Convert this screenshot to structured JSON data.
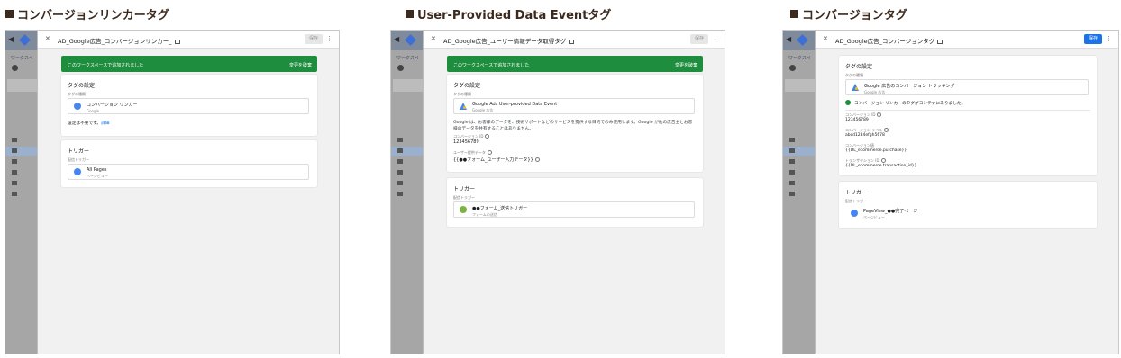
{
  "panels": [
    {
      "heading": "コンバージョンリンカータグ",
      "sidebar_partial": [
        "サマリ",
        "タグ",
        "トリガ",
        "変数",
        "フォルダ",
        "テンプ"
      ],
      "dialog": {
        "title": "AD_Google広告_コンバージョンリンカー_",
        "save_label": "保存",
        "save_enabled": false,
        "banner_message": "このワークスペースで追加されました",
        "banner_action": "変更を破棄",
        "tag_section_title": "タグの設定",
        "tag_type_label": "タグの種類",
        "tag_type_name": "コンバージョン リンカー",
        "tag_type_vendor": "Google",
        "note": "設定は不要です。",
        "note_link": "詳細",
        "trigger_section_title": "トリガー",
        "trigger_label": "配信トリガー",
        "trigger_name": "All Pages",
        "trigger_type": "ページビュー"
      }
    },
    {
      "heading": "User-Provided Data Eventタグ",
      "sidebar_partial": [
        "サマリ",
        "タグ",
        "トリガ",
        "変数",
        "フォルダ",
        "テンプ"
      ],
      "dialog": {
        "title": "AD_Google広告_ユーザー情報データ取得タグ",
        "save_label": "保存",
        "save_enabled": false,
        "banner_message": "このワークスペースで追加されました",
        "banner_action": "変更を破棄",
        "tag_section_title": "タグの設定",
        "tag_type_label": "タグの種類",
        "tag_type_name": "Google Ads User-provided Data Event",
        "tag_type_vendor": "Google 広告",
        "description": "Google は、お客様のデータを、技術サポートなどのサービスを提供する目的でのみ使用します。Google が他の広告主とお客様のデータを共有することはありません。",
        "conversion_id_label": "コンバージョン ID",
        "conversion_id_value": "123456789",
        "user_data_label": "ユーザー提供データ",
        "user_data_value": "{{●●フォーム_ユーザー入力データ}}",
        "trigger_section_title": "トリガー",
        "trigger_label": "配信トリガー",
        "trigger_name": "●●フォーム_送信トリガー",
        "trigger_type": "フォームの送信"
      }
    },
    {
      "heading": "コンバージョンタグ",
      "sidebar_partial": [
        "サマリ",
        "タグ",
        "トリガ",
        "変数",
        "フォルダ",
        "テンプ"
      ],
      "dialog": {
        "title": "AD_Google広告_コンバージョンタグ",
        "save_label": "保存",
        "save_enabled": true,
        "tag_section_title": "タグの設定",
        "tag_type_label": "タグの種類",
        "tag_type_name": "Google 広告のコンバージョン トラッキング",
        "tag_type_vendor": "Google 広告",
        "linker_notice": "コンバージョン リンカーのタグがコンテナにありました。",
        "conversion_id_label": "コンバージョン ID",
        "conversion_id_value": "123456789",
        "conversion_label_label": "コンバージョン ラベル",
        "conversion_label_value": "abcd1234efgh5678",
        "conversion_value_label": "コンバージョン値",
        "conversion_value_value": "{{DL_ecommerce.purchase}}",
        "transaction_id_label": "トランザクション ID",
        "transaction_id_value": "{{DL_ecommerce.transaction_id}}",
        "trigger_section_title": "トリガー",
        "trigger_label": "配信トリガー",
        "trigger_name": "PageView_●●完了ページ",
        "trigger_type": "ページビュー"
      }
    }
  ],
  "colors": {
    "heading": "#3c2a1e",
    "banner": "#1e8e3e",
    "primary": "#1a73e8"
  }
}
